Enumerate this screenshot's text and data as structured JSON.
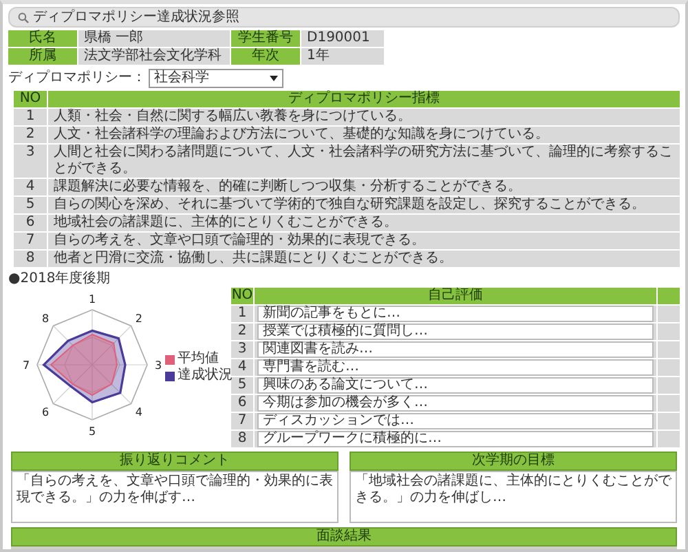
{
  "window": {
    "title": "ディプロマポリシー達成状況参照"
  },
  "student": [
    {
      "label": "氏名",
      "value": "県橋 一郎"
    },
    {
      "label": "学生番号",
      "value": "D190001"
    },
    {
      "label": "所属",
      "value": "法文学部社会文化学科"
    },
    {
      "label": "年次",
      "value": "1年"
    }
  ],
  "policy_select": {
    "label": "ディプロマポリシー：",
    "value": "社会科学"
  },
  "policy_table": {
    "columns": [
      "NO",
      "ディプロマポリシー指標"
    ],
    "rows": [
      {
        "no": "1",
        "text": "人類・社会・自然に関する幅広い教養を身につけている。"
      },
      {
        "no": "2",
        "text": "人文・社会諸科学の理論および方法について、基礎的な知識を身につけている。"
      },
      {
        "no": "3",
        "text": "人間と社会に関わる諸問題について、人文・社会諸科学の研究方法に基づいて、論理的に考察することができる。"
      },
      {
        "no": "4",
        "text": "課題解決に必要な情報を、的確に判断しつつ収集・分析することができる。"
      },
      {
        "no": "5",
        "text": "自らの関心を深め、それに基づいて学術的で独自な研究課題を設定し、探究することができる。"
      },
      {
        "no": "6",
        "text": "地域社会の諸課題に、主体的にとりくむことができる。"
      },
      {
        "no": "7",
        "text": "自らの考えを、文章や口頭で論理的・効果的に表現できる。"
      },
      {
        "no": "8",
        "text": "他者と円滑に交流・協働し、共に課題にとりくむことができる。"
      }
    ]
  },
  "term": "●2018年度後期",
  "radar": {
    "axis_labels": [
      "1",
      "2",
      "3",
      "4",
      "5",
      "6",
      "7",
      "8"
    ],
    "legend": [
      {
        "label": "平均値",
        "color": "#e0607a"
      },
      {
        "label": "達成状況",
        "color": "#4a3a9a"
      }
    ]
  },
  "self_eval": {
    "columns": [
      "NO",
      "自己評価"
    ],
    "rows": [
      {
        "no": "1",
        "value": "新聞の記事をもとに…"
      },
      {
        "no": "2",
        "value": "授業では積極的に質問し…"
      },
      {
        "no": "3",
        "value": "関連図書を読み…"
      },
      {
        "no": "4",
        "value": "専門書を読む…"
      },
      {
        "no": "5",
        "value": "興味のある論文について…"
      },
      {
        "no": "6",
        "value": "今期は参加の機会が多く…"
      },
      {
        "no": "7",
        "value": "ディスカッションでは…"
      },
      {
        "no": "8",
        "value": "グループワークに積極的に…"
      }
    ]
  },
  "comments": [
    {
      "title": "振り返りコメント",
      "value": "「自らの考えを、文章や口頭で論理的・効果的に表現できる。」の力を伸ばす…"
    },
    {
      "title": "次学期の目標",
      "value": "「地域社会の諸課題に、主体的にとりくむことができる。」の力を伸ばし…"
    }
  ],
  "interview": {
    "title": "面談結果"
  }
}
